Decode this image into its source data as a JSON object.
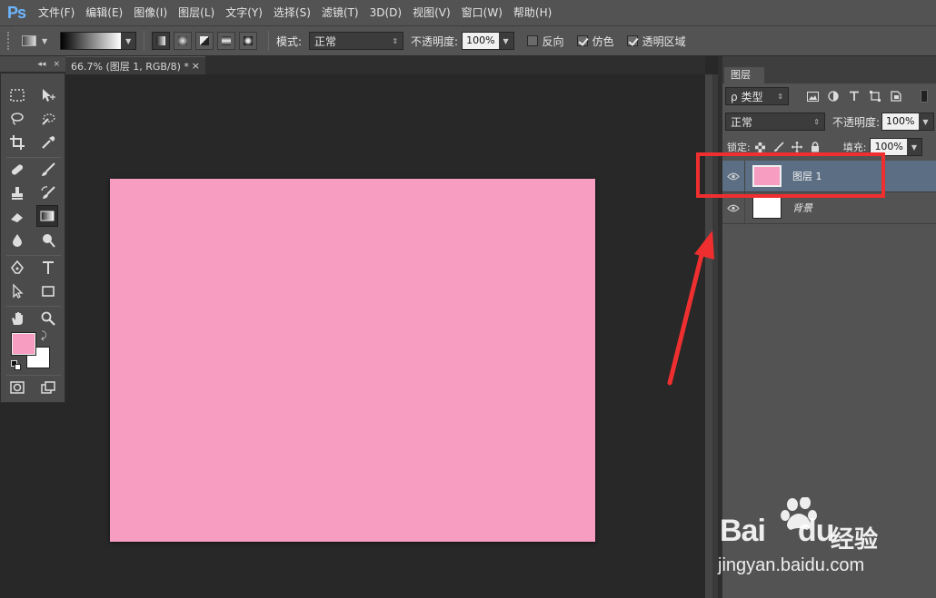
{
  "app": {
    "logo": "Ps"
  },
  "menu": [
    "文件(F)",
    "编辑(E)",
    "图像(I)",
    "图层(L)",
    "文字(Y)",
    "选择(S)",
    "滤镜(T)",
    "3D(D)",
    "视图(V)",
    "窗口(W)",
    "帮助(H)"
  ],
  "options": {
    "mode_label": "模式:",
    "mode_value": "正常",
    "opacity_label": "不透明度:",
    "opacity_value": "100%",
    "reverse_label": "反向",
    "reverse_checked": false,
    "dither_label": "仿色",
    "dither_checked": true,
    "transparency_label": "透明区域",
    "transparency_checked": true
  },
  "document": {
    "tab_title": "66.7% (图层 1, RGB/8) *",
    "close_glyph": "×",
    "canvas_color": "#f79dc1"
  },
  "tools_panel": {
    "collapse_glyph": "◂◂",
    "close_glyph": "×"
  },
  "colors": {
    "foreground": "#f79dc1",
    "background": "#ffffff"
  },
  "layers": {
    "tab_label": "图层",
    "filter_kind": "类型",
    "filter_search_glyph": "ρ",
    "blend_mode": "正常",
    "opacity_label": "不透明度:",
    "opacity_value": "100%",
    "lock_label": "锁定:",
    "fill_label": "填充:",
    "fill_value": "100%",
    "items": [
      {
        "name": "图层 1",
        "selected": true,
        "visible": true,
        "thumb_color": "#f79dc1",
        "italic": false
      },
      {
        "name": "背景",
        "selected": false,
        "visible": true,
        "thumb_color": "#ffffff",
        "italic": true
      }
    ]
  },
  "annotation": {
    "color": "#ef2f2f"
  },
  "watermark": {
    "brand": "Bai",
    "brand_suffix": "du",
    "chinese": "经验",
    "url": "jingyan.baidu.com"
  }
}
